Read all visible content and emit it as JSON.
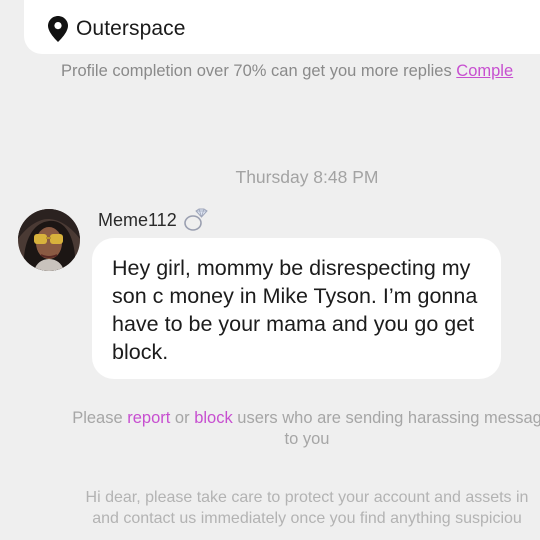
{
  "location": {
    "icon": "location-pin-icon",
    "text": "Outerspace"
  },
  "profile_completion": {
    "message": "Profile completion over 70% can get you more replies ",
    "link": "Comple"
  },
  "chat": {
    "timestamp": "Thursday 8:48 PM",
    "message": {
      "sender": "Meme112",
      "badge_icon": "diamond-ring-icon",
      "text": "Hey girl, mommy be disrespecting my son c money in Mike Tyson. I’m gonna have to be your mama and you go get block."
    }
  },
  "harassment_notice": {
    "prefix": "Please ",
    "report_link": "report",
    "middle": " or ",
    "block_link": "block",
    "suffix": " users who are sending harassing messag",
    "line2": "to you"
  },
  "safety_notice": {
    "line1": "Hi dear, please take care to protect your account and assets in",
    "line2": "and contact us immediately once you find anything suspiciou"
  },
  "colors": {
    "background": "#efefef",
    "link": "#c74fd0",
    "bubble": "#ffffff"
  }
}
